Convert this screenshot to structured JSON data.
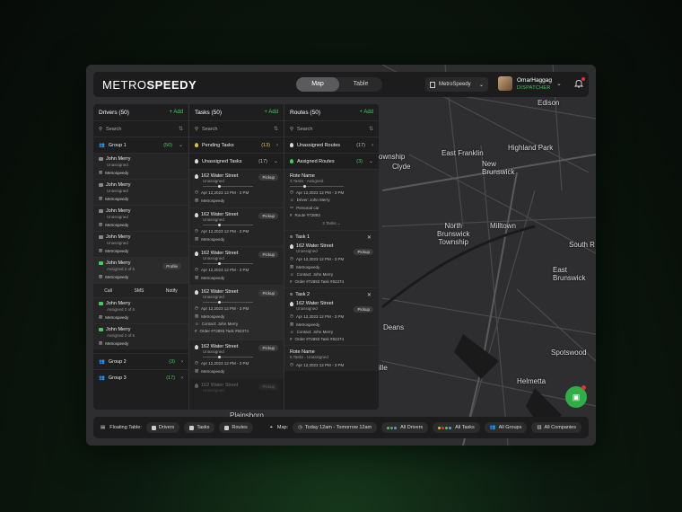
{
  "brand": {
    "part1": "METRO",
    "part2": "SPEEDY"
  },
  "view_toggle": {
    "map": "Map",
    "table": "Table"
  },
  "org_selector": "MetroSpeedy",
  "user": {
    "name": "OmarHaggag",
    "role": "DISPATCHER"
  },
  "drivers_panel": {
    "title": "Drivers",
    "count": "(50)",
    "add": "+ Add",
    "search": "Search",
    "group1": {
      "label": "Group 1",
      "count": "(50)"
    },
    "drivers": [
      {
        "name": "John Merry",
        "status": "Unassigned",
        "company": "Metrospeedy"
      },
      {
        "name": "John Merry",
        "status": "Unassigned",
        "company": "Metrospeedy"
      },
      {
        "name": "John Merry",
        "status": "Unassigned",
        "company": "Metrospeedy"
      },
      {
        "name": "John Merry",
        "status": "Unassigned",
        "company": "Metrospeedy"
      },
      {
        "name": "John Merry",
        "status": "Assigned 2 of 6",
        "company": "Metrospeedy",
        "button": "Profile"
      },
      {
        "name": "John Merry",
        "status": "Assigned 2 of 6",
        "company": "Metrospeedy"
      },
      {
        "name": "John Merry",
        "status": "Assigned 2 of 6",
        "company": "Metrospeedy"
      }
    ],
    "actions": {
      "call": "Call",
      "sms": "SMS",
      "notify": "Notify"
    },
    "group2": {
      "label": "Group 2",
      "count": "(3)"
    },
    "group3": {
      "label": "Group 3",
      "count": "(17)"
    }
  },
  "tasks_panel": {
    "title": "Tasks",
    "count": "(50)",
    "add": "+ Add",
    "search": "Search",
    "pending": {
      "label": "Pending Tasks",
      "count": "(13)"
    },
    "unassigned": {
      "label": "Unassigned Tasks",
      "count": "(17)"
    },
    "tasks": [
      {
        "address": "162 Water Street",
        "status": "Unassigned",
        "time": "Apr 12,2023 12 PM - 3 PM",
        "company": "Metrospeedy",
        "tag": "Pickup"
      },
      {
        "address": "162 Water Street",
        "status": "Unassigned",
        "time": "Apr 12,2023 12 PM - 3 PM",
        "company": "Metrospeedy",
        "tag": "Pickup"
      },
      {
        "address": "162 Water Street",
        "status": "Unassigned",
        "time": "Apr 12,2023 12 PM - 3 PM",
        "company": "Metrospeedy",
        "tag": "Pickup"
      },
      {
        "address": "162 Water Street",
        "status": "Unassigned",
        "time": "Apr 12,2023 12 PM - 3 PM",
        "company": "Metrospeedy",
        "tag": "Pickup",
        "contact": "Contact: John Merry",
        "order": "Order #72893   Task #92374"
      },
      {
        "address": "162 Water Street",
        "status": "Unassigned",
        "time": "Apr 12,2023 12 PM - 3 PM",
        "company": "Metrospeedy",
        "tag": "Pickup"
      },
      {
        "address": "162 Water Street",
        "status": "Unassigned",
        "tag": "Pickup"
      }
    ]
  },
  "routes_panel": {
    "title": "Routes",
    "count": "(50)",
    "add": "+ Add",
    "search": "Search",
    "unassigned": {
      "label": "Unassigned Routes",
      "count": "(17)"
    },
    "assigned": {
      "label": "Assigned Routes",
      "count": "(3)"
    },
    "route1": {
      "name": "Rote Name",
      "sub": "3 Tasks - Assigned",
      "time": "Apr 12,2023 12 PM - 3 PM",
      "driver": "Driver: John Merry",
      "vehicle": "Personal car",
      "route": "Route #72893",
      "tasks": "3 Tasks"
    },
    "task1": {
      "label": "Task 1",
      "address": "162 Water Street",
      "status": "Unassigned",
      "tag": "Pickup",
      "time": "Apr 12,2023 12 PM - 3 PM",
      "company": "Metrospeedy",
      "contact": "Contact: John Merry",
      "order": "Order #72893   Task #92374"
    },
    "task2": {
      "label": "Task 2",
      "address": "162 Water Street",
      "status": "Unassigned",
      "tag": "Pickup",
      "time": "Apr 12,2023 12 PM - 3 PM",
      "company": "Metrospeedy",
      "contact": "Contact: John Merry",
      "order": "Order #72893   Task #92374"
    },
    "route2": {
      "name": "Rote Name",
      "sub": "6 Tasks - Unassigned",
      "time": "Apr 12,2023 12 PM - 3 PM"
    }
  },
  "map_labels": {
    "edison": "Edison",
    "highland_park": "Highland Park",
    "east_franklin": "East Franklin",
    "new_brunswick": "New\nBrunswick",
    "north_brunswick": "North\nBrunswick\nTownship",
    "milltown": "Milltown",
    "south_r": "South R",
    "east_brunswick": "East\nBrunswick",
    "deans": "Deans",
    "spotswood": "Spotswood",
    "helmetta": "Helmetta",
    "clyde": "Clyde",
    "ownship": "ownship",
    "plainsboro": "Plainsboro",
    "ille": "ille"
  },
  "bottom_bar": {
    "floating_table": "Floating Table:",
    "drivers": "Drivers",
    "tasks": "Tasks",
    "routes": "Routes",
    "map": "Map:",
    "date_range": "Today 12am - Tomorrow 12am",
    "all_drivers": "All Drivers",
    "all_tasks": "All Tasks",
    "all_groups": "All Groups",
    "all_companies": "All Companies"
  },
  "colors": {
    "accent": "#3fcf5c",
    "pending": "#e2c033",
    "alert": "#e0323a"
  }
}
